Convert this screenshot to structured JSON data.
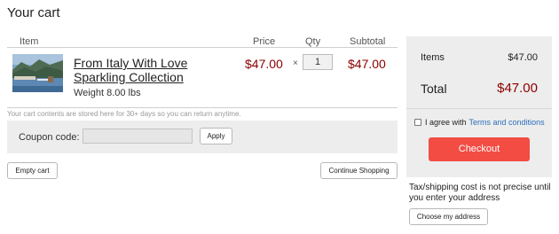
{
  "page": {
    "title": "Your cart"
  },
  "table": {
    "headers": {
      "item": "Item",
      "price": "Price",
      "qty": "Qty",
      "subtotal": "Subtotal"
    }
  },
  "item": {
    "name": "From Italy With Love Sparkling Collection",
    "weight": "Weight 8.00 lbs",
    "price": "$47.00",
    "times_symbol": "×",
    "quantity": "1",
    "subtotal": "$47.00",
    "thumbnail": "lake-landscape-photo"
  },
  "storage_note": "Your cart contents are stored here for 30+ days so you can return anytime.",
  "coupon": {
    "label": "Coupon code:",
    "value": "",
    "apply_label": "Apply"
  },
  "buttons": {
    "empty_cart": "Empty cart",
    "continue_shopping": "Continue Shopping",
    "checkout": "Checkout",
    "choose_address": "Choose my address"
  },
  "summary": {
    "items_label": "Items",
    "items_value": "$47.00",
    "total_label": "Total",
    "total_value": "$47.00",
    "agree_text": "I agree with",
    "terms_link": "Terms and conditions",
    "agree_checked": false
  },
  "shipping_note": "Tax/shipping cost is not precise until you enter your address",
  "colors": {
    "price": "#8b0000",
    "checkout_bg": "#f24c43",
    "link": "#2a6ebb",
    "panel_bg": "#ededed"
  }
}
